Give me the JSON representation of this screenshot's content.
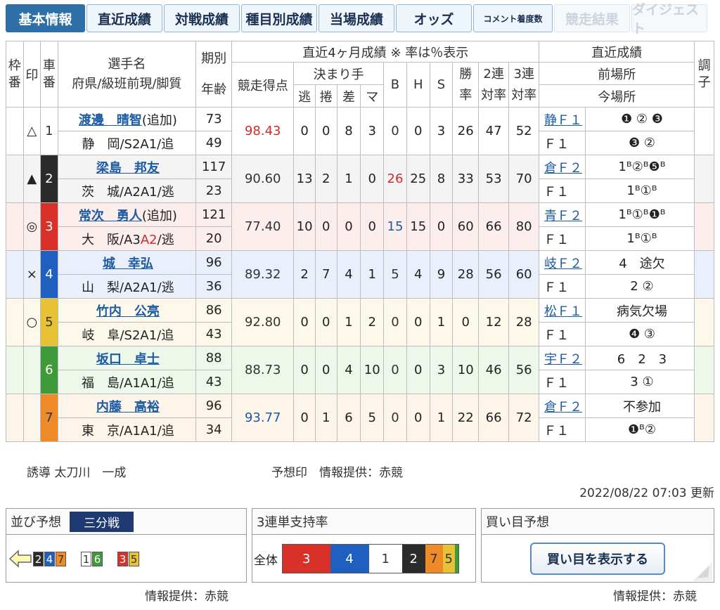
{
  "tabs": [
    {
      "label": "基本情報",
      "w": 113,
      "state": "active"
    },
    {
      "label": "直近成績",
      "w": 108,
      "state": "normal"
    },
    {
      "label": "対戦成績",
      "w": 108,
      "state": "normal"
    },
    {
      "label": "種目別成績",
      "w": 108,
      "state": "normal"
    },
    {
      "label": "当場成績",
      "w": 108,
      "state": "normal"
    },
    {
      "label": "オッズ",
      "w": 108,
      "state": "normal"
    },
    {
      "label": "コメント着度数",
      "w": 113,
      "state": "small"
    },
    {
      "label": "競走結果",
      "w": 108,
      "state": "disabled"
    },
    {
      "label": "ダイジェスト",
      "w": 108,
      "state": "disabled"
    }
  ],
  "headers": {
    "waku": "枠番",
    "mark": "印",
    "car": "車番",
    "name1": "選手名",
    "name2": "府県/級班前現/脚質",
    "term1": "期別",
    "term2": "年齢",
    "recent_title": "直近4ヶ月成績 ※ 率は％表示",
    "score": "競走得点",
    "kimarite": "決まり手",
    "nige": "逃",
    "makuri": "捲",
    "sashi": "差",
    "ma": "マ",
    "b": "B",
    "h": "H",
    "s": "S",
    "win": "勝率",
    "ren2": "2連対率",
    "ren3": "3連対率",
    "recent_results": "直近成績",
    "prev_venue": "前場所",
    "this_venue": "今場所",
    "condition": "調子"
  },
  "riders": [
    {
      "mark": "△",
      "car": "1",
      "car_color": "#ffffff",
      "car_text": "#333333",
      "bg": "#ffffff",
      "name": "渡邊　晴智",
      "extra": "(追加)",
      "pref": "静　岡/S2A1/追",
      "pref_hl": "",
      "term": "73",
      "age": "49",
      "score": "98.43",
      "score_color": "#d22b2b",
      "nige": "0",
      "makuri": "0",
      "sashi": "8",
      "ma": "3",
      "b": "0",
      "b_color": "",
      "h": "0",
      "s": "3",
      "win": "26",
      "ren2": "47",
      "ren3": "52",
      "prev_venue": "静Ｆ１",
      "prev_res": "❶ ② ❸",
      "this_venue": "Ｆ１",
      "this_res": "❸ ②"
    },
    {
      "mark": "▲",
      "car": "2",
      "car_color": "#2b2b2b",
      "car_text": "#ffffff",
      "bg": "#f4f4f4",
      "name": "梁島　邦友",
      "extra": "",
      "pref": "茨　城/A2A1/逃",
      "pref_hl": "",
      "term": "117",
      "age": "23",
      "score": "90.60",
      "score_color": "#333333",
      "nige": "13",
      "makuri": "2",
      "sashi": "1",
      "ma": "0",
      "b": "26",
      "b_color": "#d22b2b",
      "h": "25",
      "s": "8",
      "win": "33",
      "ren2": "53",
      "ren3": "70",
      "prev_venue": "倉Ｆ２",
      "prev_res": "1ᴮ②ᴮ❺ᴮ",
      "this_venue": "Ｆ１",
      "this_res": "1ᴮ①ᴮ"
    },
    {
      "mark": "◎",
      "car": "3",
      "car_color": "#d9302a",
      "car_text": "#ffffff",
      "bg": "#fdeeee",
      "name": "常次　勇人",
      "extra": "(追加)",
      "pref": "大　阪/A3",
      "pref_hl": "A2",
      "pref_tail": "/逃",
      "term": "121",
      "age": "20",
      "score": "77.40",
      "score_color": "#333333",
      "nige": "10",
      "makuri": "0",
      "sashi": "0",
      "ma": "0",
      "b": "15",
      "b_color": "#1c5ba3",
      "h": "15",
      "s": "0",
      "win": "60",
      "ren2": "66",
      "ren3": "80",
      "prev_venue": "青Ｆ２",
      "prev_res": "1ᴮ①ᴮ❶ᴮ",
      "this_venue": "Ｆ１",
      "this_res": "1ᴮ①ᴮ"
    },
    {
      "mark": "×",
      "car": "4",
      "car_color": "#1f5fbf",
      "car_text": "#ffffff",
      "bg": "#eaf0fb",
      "name": "城　幸弘",
      "extra": "",
      "pref": "山　梨/A2A1/逃",
      "pref_hl": "",
      "term": "96",
      "age": "36",
      "score": "89.32",
      "score_color": "#333333",
      "nige": "2",
      "makuri": "7",
      "sashi": "4",
      "ma": "1",
      "b": "5",
      "b_color": "",
      "h": "4",
      "s": "9",
      "win": "28",
      "ren2": "56",
      "ren3": "60",
      "prev_venue": "岐Ｆ２",
      "prev_res": "4　途欠",
      "this_venue": "Ｆ１",
      "this_res": "2 ②"
    },
    {
      "mark": "○",
      "car": "5",
      "car_color": "#e8c235",
      "car_text": "#333333",
      "bg": "#fdf9ea",
      "name": "竹内　公亮",
      "extra": "",
      "pref": "岐　阜/S2A1/追",
      "pref_hl": "",
      "term": "86",
      "age": "43",
      "score": "92.80",
      "score_color": "#333333",
      "nige": "0",
      "makuri": "0",
      "sashi": "1",
      "ma": "2",
      "b": "0",
      "b_color": "",
      "h": "0",
      "s": "1",
      "win": "0",
      "ren2": "12",
      "ren3": "28",
      "prev_venue": "松Ｆ１",
      "prev_res": "病気欠場",
      "this_venue": "Ｆ１",
      "this_res": "❹ ③"
    },
    {
      "mark": "",
      "car": "6",
      "car_color": "#3f9a3c",
      "car_text": "#ffffff",
      "bg": "#eef8ea",
      "name": "坂口　卓士",
      "extra": "",
      "pref": "福　島/A1A1/追",
      "pref_hl": "",
      "term": "88",
      "age": "43",
      "score": "88.73",
      "score_color": "#333333",
      "nige": "0",
      "makuri": "0",
      "sashi": "4",
      "ma": "10",
      "b": "0",
      "b_color": "",
      "h": "0",
      "s": "3",
      "win": "10",
      "ren2": "46",
      "ren3": "56",
      "prev_venue": "宇Ｆ２",
      "prev_res": "6　2　3",
      "this_venue": "Ｆ１",
      "this_res": "3 ①"
    },
    {
      "mark": "",
      "car": "7",
      "car_color": "#ee8a28",
      "car_text": "#333333",
      "bg": "#fdf4ea",
      "name": "内藤　高裕",
      "extra": "",
      "pref": "東　京/A1A1/追",
      "pref_hl": "",
      "term": "96",
      "age": "34",
      "score": "93.77",
      "score_color": "#1c5ba3",
      "nige": "0",
      "makuri": "1",
      "sashi": "6",
      "ma": "5",
      "b": "0",
      "b_color": "",
      "h": "0",
      "s": "1",
      "win": "22",
      "ren2": "66",
      "ren3": "72",
      "prev_venue": "倉Ｆ２",
      "prev_res": "不参加",
      "this_venue": "Ｆ１",
      "this_res": "❶ᴮ②"
    }
  ],
  "footer": {
    "guide": "誘導 太刀川　一成",
    "yosoin": "予想印　情報提供：赤競",
    "updated": "2022/08/22 07:03 更新"
  },
  "narabi": {
    "title": "並び予想",
    "badge": "三分戦",
    "source": "情報提供：赤競",
    "groups": [
      [
        {
          "n": "2",
          "c": "#2b2b2b",
          "t": "#fff"
        },
        {
          "n": "4",
          "c": "#1f5fbf",
          "t": "#fff"
        },
        {
          "n": "7",
          "c": "#ee8a28",
          "t": "#333"
        }
      ],
      [
        {
          "n": "1",
          "c": "#ffffff",
          "t": "#333"
        },
        {
          "n": "6",
          "c": "#3f9a3c",
          "t": "#fff"
        }
      ],
      [
        {
          "n": "3",
          "c": "#d9302a",
          "t": "#fff"
        },
        {
          "n": "5",
          "c": "#e8c235",
          "t": "#333"
        }
      ]
    ]
  },
  "support": {
    "title": "3連単支持率",
    "label": "全体",
    "bars": [
      {
        "n": "3",
        "c": "#d9302a",
        "t": "#fff",
        "share": 0.27
      },
      {
        "n": "4",
        "c": "#1f5fbf",
        "t": "#fff",
        "share": 0.22
      },
      {
        "n": "1",
        "c": "#ffffff",
        "t": "#333",
        "share": 0.19
      },
      {
        "n": "2",
        "c": "#2b2b2b",
        "t": "#fff",
        "share": 0.13
      },
      {
        "n": "7",
        "c": "#ee8a28",
        "t": "#333",
        "share": 0.1
      },
      {
        "n": "5",
        "c": "#e8c235",
        "t": "#333",
        "share": 0.07
      },
      {
        "n": "",
        "c": "#3f9a3c",
        "t": "#fff",
        "share": 0.02
      }
    ]
  },
  "kaime": {
    "title": "買い目予想",
    "button": "買い目を表示する",
    "source": "情報提供：赤競"
  }
}
